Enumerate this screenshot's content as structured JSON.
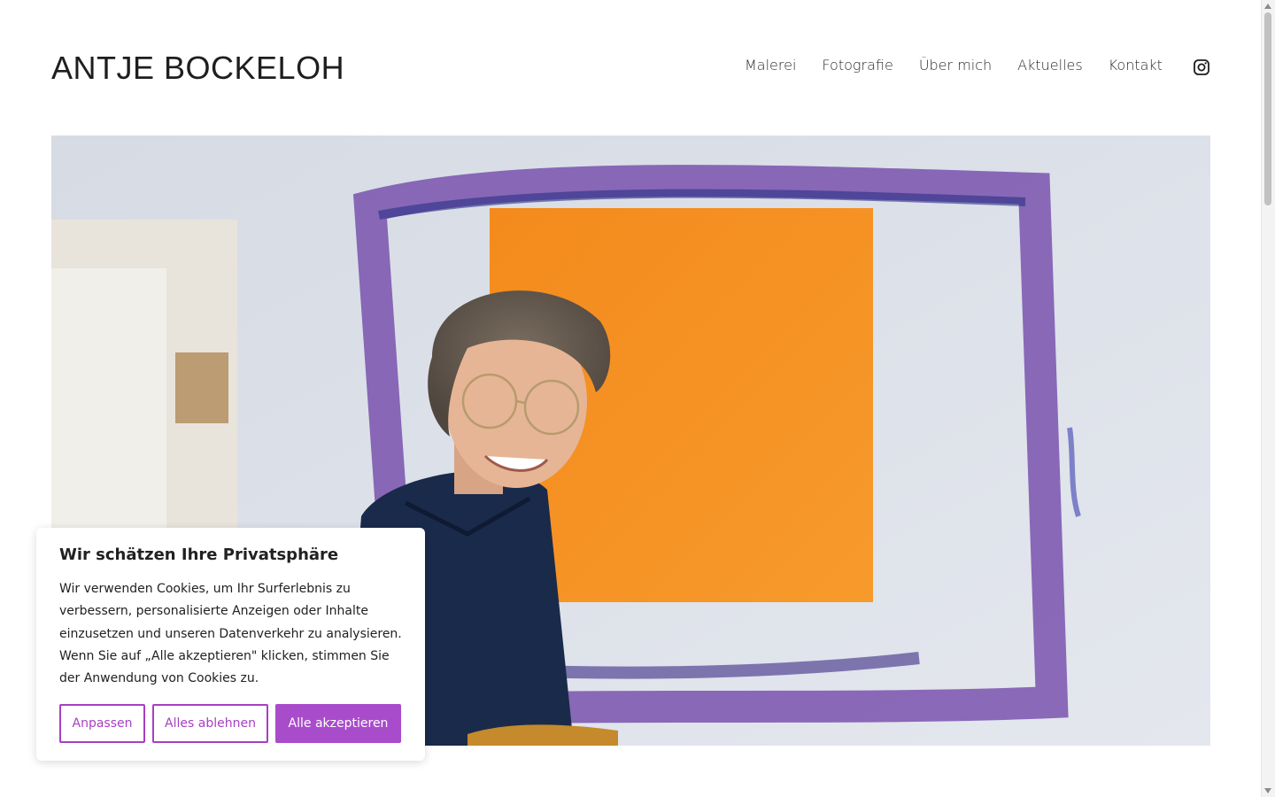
{
  "header": {
    "site_title": "ANTJE BOCKELOH",
    "nav": [
      "Malerei",
      "Fotografie",
      "Über mich",
      "Aktuelles",
      "Kontakt"
    ],
    "social_icon": "instagram-icon"
  },
  "hero": {
    "image_alt": "Portrait of the artist in front of an orange painting"
  },
  "cookie_banner": {
    "title": "Wir schätzen Ihre Privatsphäre",
    "text": "Wir verwenden Cookies, um Ihr Surferlebnis zu verbessern, personalisierte Anzeigen oder Inhalte einzusetzen und unseren Datenverkehr zu analysieren. Wenn Sie auf „Alle akzeptieren\" klicken, stimmen Sie der Anwendung von Cookies zu.",
    "buttons": {
      "customize": "Anpassen",
      "reject": "Alles ablehnen",
      "accept": "Alle akzeptieren"
    },
    "accent_color": "#a94ccb"
  }
}
